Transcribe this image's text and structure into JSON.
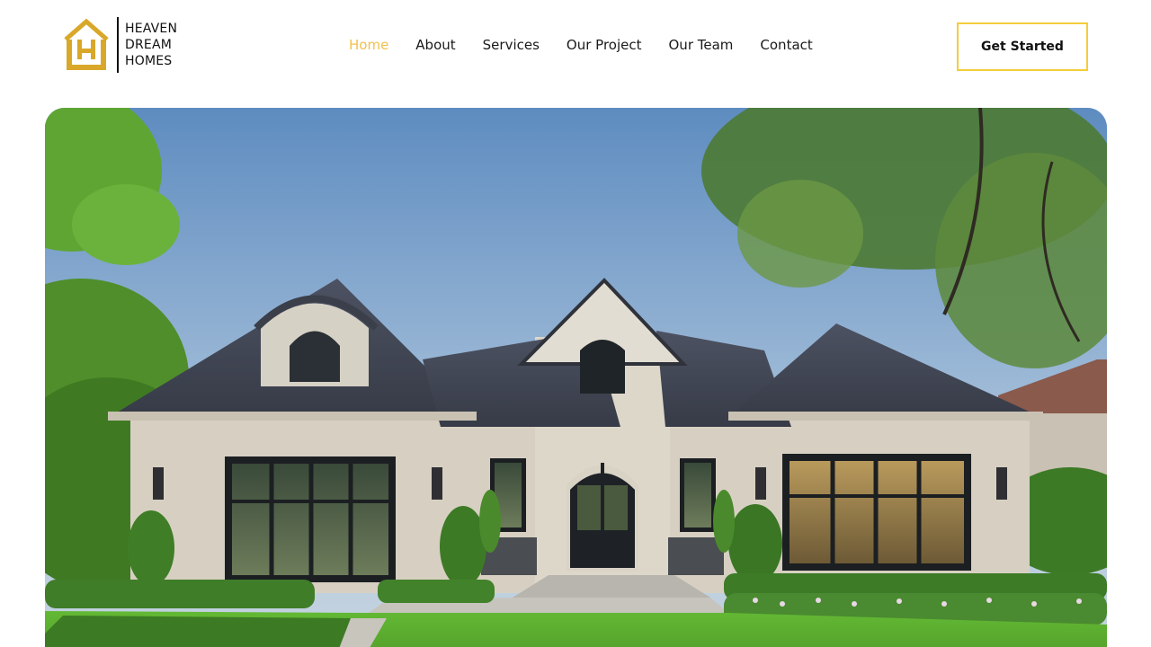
{
  "brand": {
    "name_lines": [
      "HEAVEN",
      "DREAM",
      "HOMES"
    ],
    "colors": {
      "gold": "#d9a82a",
      "accent": "#f2c14e",
      "cta_border": "#f4cd3a"
    }
  },
  "nav": {
    "items": [
      {
        "label": "Home",
        "active": true
      },
      {
        "label": "About",
        "active": false
      },
      {
        "label": "Services",
        "active": false
      },
      {
        "label": "Our Project",
        "active": false
      },
      {
        "label": "Our Team",
        "active": false
      },
      {
        "label": "Contact",
        "active": false
      }
    ]
  },
  "cta": {
    "label": "Get Started"
  },
  "hero": {
    "image": "luxury-house-photo"
  }
}
